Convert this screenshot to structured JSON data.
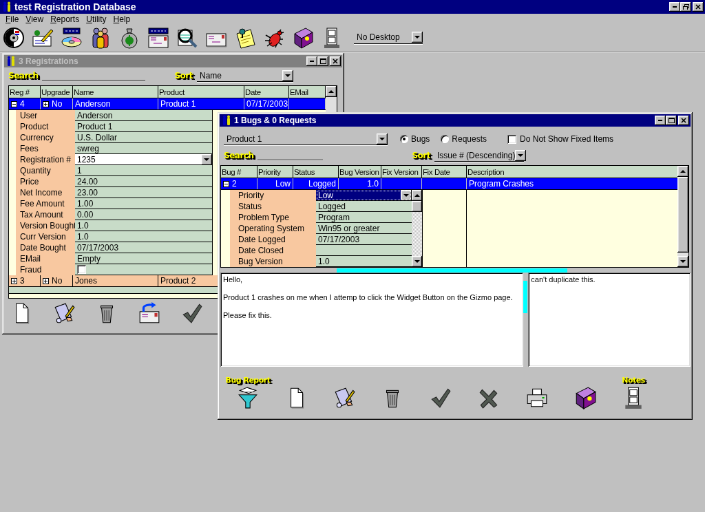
{
  "app": {
    "title": "test Registration Database",
    "active": true
  },
  "menu": [
    {
      "label": "File"
    },
    {
      "label": "View"
    },
    {
      "label": "Reports"
    },
    {
      "label": "Utility"
    },
    {
      "label": "Help"
    }
  ],
  "desktop_select": {
    "value": "No Desktop"
  },
  "registrations": {
    "title": "3 Registrations",
    "active": false,
    "search": {
      "label": "Search"
    },
    "sort": {
      "label": "Sort",
      "value": "Name"
    },
    "columns": [
      "Reg #",
      "Upgrade",
      "Name",
      "Product",
      "Date",
      "EMail"
    ],
    "rows": [
      {
        "cells": [
          "4",
          "No",
          "Anderson",
          "Product 1",
          "07/17/2003"
        ],
        "selected": true,
        "expanded": true,
        "upgrade_expanded": false,
        "details": [
          {
            "label": "User",
            "value": "Anderson",
            "kind": "text"
          },
          {
            "label": "Product",
            "value": "Product 1",
            "kind": "text"
          },
          {
            "label": "Currency",
            "value": "U.S. Dollar",
            "kind": "text"
          },
          {
            "label": "Fees",
            "value": "swreg",
            "kind": "text"
          },
          {
            "label": "Registration #",
            "value": "1235",
            "kind": "dropdown"
          },
          {
            "label": "Quantity",
            "value": "1",
            "kind": "text"
          },
          {
            "label": "Price",
            "value": "24.00",
            "kind": "text"
          },
          {
            "label": "Net Income",
            "value": "23.00",
            "kind": "text"
          },
          {
            "label": "Fee Amount",
            "value": "1.00",
            "kind": "text"
          },
          {
            "label": "Tax Amount",
            "value": "0.00",
            "kind": "text"
          },
          {
            "label": "Version Bought",
            "value": "1.0",
            "kind": "text"
          },
          {
            "label": "Curr Version",
            "value": "1.0",
            "kind": "text"
          },
          {
            "label": "Date Bought",
            "value": "07/17/2003",
            "kind": "text"
          },
          {
            "label": "EMail",
            "value": "Empty",
            "kind": "text"
          },
          {
            "label": "Fraud",
            "kind": "checkbox",
            "checked": false
          }
        ]
      },
      {
        "cells": [
          "3",
          "No",
          "Jones",
          "Product 2"
        ],
        "selected": false,
        "expanded": false,
        "upgrade_expanded": false
      }
    ]
  },
  "bugs": {
    "title": "1 Bugs & 0 Requests",
    "active": true,
    "product": {
      "value": "Product 1"
    },
    "filters": [
      {
        "label": "Bugs",
        "selected": true
      },
      {
        "label": "Requests",
        "selected": false
      }
    ],
    "hide_fixed": {
      "label": "Do Not Show Fixed Items",
      "checked": false
    },
    "search": {
      "label": "Search"
    },
    "sort": {
      "label": "Sort",
      "value": "Issue # (Descending)"
    },
    "columns": [
      "Bug #",
      "Priority",
      "Status",
      "Bug Version",
      "Fix Version",
      "Fix Date",
      "Description"
    ],
    "rows": [
      {
        "cells": [
          "2",
          "Low",
          "Logged",
          "1.0",
          null,
          null,
          "Program Crashes"
        ],
        "selected": true,
        "expanded": true,
        "details": [
          {
            "label": "Priority",
            "value": "Low",
            "kind": "dropdown",
            "focused": true
          },
          {
            "label": "Status",
            "value": "Logged",
            "kind": "text"
          },
          {
            "label": "Problem Type",
            "value": "Program",
            "kind": "text"
          },
          {
            "label": "Operating System",
            "value": "Win95 or greater",
            "kind": "text"
          },
          {
            "label": "Date Logged",
            "value": "07/17/2003",
            "kind": "text"
          },
          {
            "label": "Date Closed",
            "kind": "text"
          },
          {
            "label": "Bug Version",
            "value": "1.0",
            "kind": "text"
          }
        ]
      }
    ],
    "report_label": "Bug Report",
    "notes_label": "Notes",
    "report": [
      "Hello,",
      "Product 1 crashes on me when I attemp to click the Widget Button on the Gizmo page.",
      "Please fix this."
    ],
    "notes": [
      "can't duplicate this."
    ]
  }
}
